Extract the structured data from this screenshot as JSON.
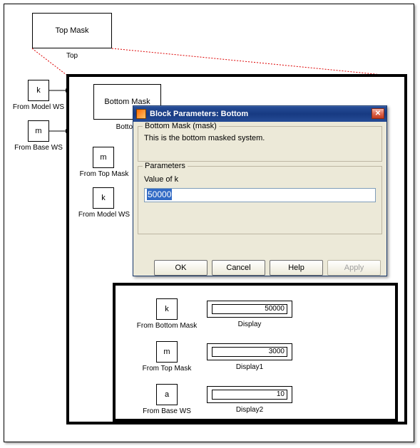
{
  "top": {
    "mask_label": "Top Mask",
    "label": "Top"
  },
  "fromModelWS": {
    "var": "k",
    "label": "From Model WS"
  },
  "fromBaseWS": {
    "var": "m",
    "label": "From Base WS"
  },
  "mid": {
    "mask_label": "Bottom Mask",
    "label": "Bottom",
    "fromTop": {
      "var": "m",
      "label": "From Top Mask"
    },
    "fromModel": {
      "var": "k",
      "label": "From Model WS"
    }
  },
  "dialog": {
    "title": "Block Parameters: Bottom",
    "group1_title": "Bottom Mask (mask)",
    "group1_desc": "This is the bottom masked system.",
    "group2_title": "Parameters",
    "param_label": "Value of k",
    "param_value": "50000",
    "ok": "OK",
    "cancel": "Cancel",
    "help": "Help",
    "apply": "Apply"
  },
  "inner": {
    "row1": {
      "var": "k",
      "src": "From Bottom Mask",
      "value": "50000",
      "disp": "Display"
    },
    "row2": {
      "var": "m",
      "src": "From Top Mask",
      "value": "3000",
      "disp": "Display1"
    },
    "row3": {
      "var": "a",
      "src": "From Base WS",
      "value": "10",
      "disp": "Display2"
    }
  }
}
